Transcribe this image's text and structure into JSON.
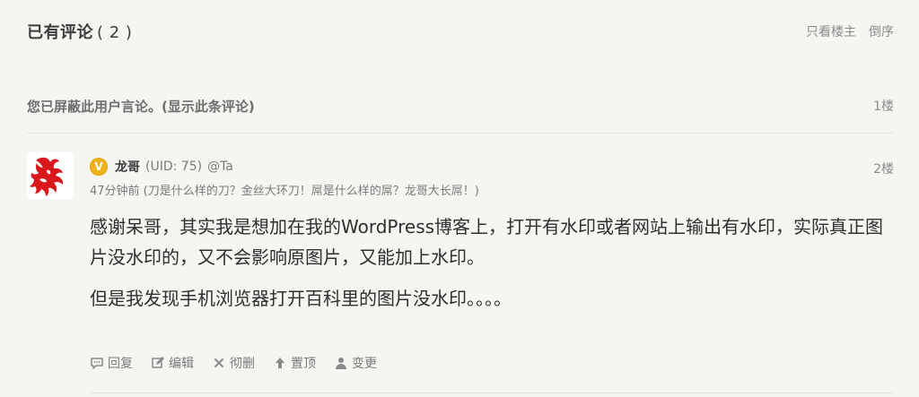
{
  "header": {
    "title": "已有评论",
    "count": "( 2 )",
    "only_author": "只看楼主",
    "reverse": "倒序"
  },
  "blocked": {
    "text": "您已屏蔽此用户言论。",
    "show_link": "(显示此条评论)",
    "floor": "1楼"
  },
  "comment": {
    "badge": "V",
    "username": "龙哥",
    "uid": "(UID: 75)",
    "at": "@Ta",
    "floor": "2楼",
    "subline": "47分钟前 (刀是什么样的刀？金丝大环刀！屌是什么样的屌？龙哥大长屌！)",
    "paragraph1": "感谢呆哥，其实我是想加在我的WordPress博客上，打开有水印或者网站上输出有水印，实际真正图片没水印的，又不会影响原图片，又能加上水印。",
    "paragraph2": "但是我发现手机浏览器打开百科里的图片没水印。。。。",
    "actions": {
      "reply": "回复",
      "edit": "编辑",
      "delete": "彻删",
      "pin": "置顶",
      "change": "变更"
    }
  },
  "colors": {
    "background": "#f6f5f2",
    "badge": "#f0b21a",
    "avatar_red": "#d8161b"
  }
}
